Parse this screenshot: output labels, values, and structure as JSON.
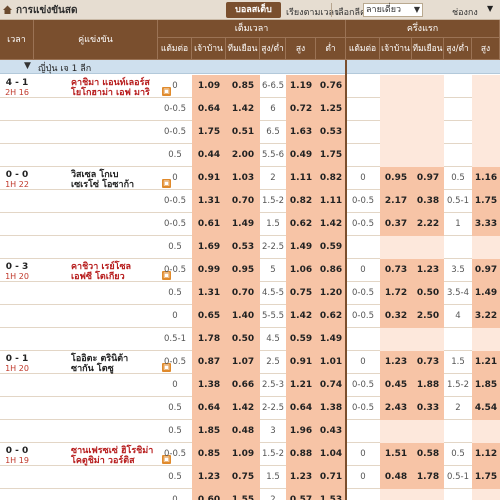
{
  "header": {
    "title": "การแข่งขันสด",
    "live_button": "บอลสเต็บ",
    "sort_label": "เรียงตามเวลา",
    "select_league_label": "เลือกลีค",
    "dropdown_value": "ลายเดี่ยว",
    "channel_label": "ช่องกง"
  },
  "columns": {
    "time": "เวลา",
    "match": "คู่แข่งขัน",
    "full_time": "เต็มเวลา",
    "half_time": "ครึ่งแรก",
    "handicap": "แต้มต่อ",
    "home": "เจ้าบ้าน",
    "away": "ทีมเยือน",
    "ou": "สูง/ต่ำ",
    "over": "สูง",
    "under": "ต่ำ",
    "h_handicap": "แต้มต่อ",
    "h_home": "เจ้าบ้าน",
    "h_away": "ทีมเยือน",
    "h_ou": "สูง/ต่ำ",
    "h_over": "สูง"
  },
  "league": {
    "name": "ญี่ปุ่น เจ 1 ลีก"
  },
  "icon_labels": {
    "tv": "▣",
    "l": "L",
    "star": "★"
  },
  "matches": [
    {
      "score": "4 - 1",
      "time": "2H 16",
      "home": "คาชิมา แอนท์เลอร์ส",
      "away": "โยโกฮาม่า เอฟ มารินอส",
      "home_red": true,
      "lines": [
        {
          "hcap": "0",
          "home": "1.09",
          "away": "0.85",
          "ou": "6-6.5",
          "over": "1.19",
          "under": "0.76"
        },
        {
          "hcap": "0-0.5",
          "home": "0.64",
          "away": "1.42",
          "ou": "6",
          "over": "0.72",
          "under": "1.25"
        },
        {
          "hcap": "0-0.5",
          "home": "1.75",
          "away": "0.51",
          "ou": "6.5",
          "over": "1.63",
          "under": "0.53"
        },
        {
          "hcap": "0.5",
          "home": "0.44",
          "away": "2.00",
          "ou": "5.5-6",
          "over": "0.49",
          "under": "1.75"
        }
      ]
    },
    {
      "score": "0 - 0",
      "time": "1H 22",
      "home": "วิสเซล โกเบ",
      "away": "เซเรโซ่ โอซาก้า",
      "home_red": false,
      "lines": [
        {
          "hcap": "0",
          "home": "0.91",
          "away": "1.03",
          "ou": "2",
          "over": "1.11",
          "under": "0.82",
          "hhcap": "0",
          "hhome": "0.95",
          "haway": "0.97",
          "hou": "0.5",
          "hover": "1.16"
        },
        {
          "hcap": "0-0.5",
          "home": "1.31",
          "away": "0.70",
          "ou": "1.5-2",
          "over": "0.82",
          "under": "1.11",
          "hhcap": "0-0.5",
          "hhome": "2.17",
          "haway": "0.38",
          "hou": "0.5-1",
          "hover": "1.75"
        },
        {
          "hcap": "0-0.5",
          "home": "0.61",
          "away": "1.49",
          "ou": "1.5",
          "over": "0.62",
          "under": "1.42",
          "hhcap": "0-0.5",
          "hhome": "0.37",
          "haway": "2.22",
          "hou": "1",
          "hover": "3.33"
        },
        {
          "hcap": "0.5",
          "home": "1.69",
          "away": "0.53",
          "ou": "2-2.5",
          "over": "1.49",
          "under": "0.59"
        }
      ]
    },
    {
      "score": "0 - 3",
      "time": "1H 20",
      "home": "คาชิวา เรย์โซล",
      "away": "เอฟซี โตเกียว",
      "home_red": true,
      "lines": [
        {
          "hcap": "0-0.5",
          "home": "0.99",
          "away": "0.95",
          "ou": "5",
          "over": "1.06",
          "under": "0.86",
          "hhcap": "0",
          "hhome": "0.73",
          "haway": "1.23",
          "hou": "3.5",
          "hover": "0.97"
        },
        {
          "hcap": "0.5",
          "home": "1.31",
          "away": "0.70",
          "ou": "4.5-5",
          "over": "0.75",
          "under": "1.20",
          "hhcap": "0-0.5",
          "hhome": "1.72",
          "haway": "0.50",
          "hou": "3.5-4",
          "hover": "1.49"
        },
        {
          "hcap": "0",
          "home": "0.65",
          "away": "1.40",
          "ou": "5-5.5",
          "over": "1.42",
          "under": "0.62",
          "hhcap": "0-0.5",
          "hhome": "0.32",
          "haway": "2.50",
          "hou": "4",
          "hover": "3.22"
        },
        {
          "hcap": "0.5-1",
          "home": "1.78",
          "away": "0.50",
          "ou": "4.5",
          "over": "0.59",
          "under": "1.49"
        }
      ]
    },
    {
      "score": "0 - 1",
      "time": "1H 20",
      "home": "โออิตะ ตรินิต้า",
      "away": "ซากัน โตซู",
      "home_red": false,
      "lines": [
        {
          "hcap": "0-0.5",
          "home": "0.87",
          "away": "1.07",
          "ou": "2.5",
          "over": "0.91",
          "under": "1.01",
          "hhcap": "0",
          "hhome": "1.23",
          "haway": "0.73",
          "hou": "1.5",
          "hover": "1.21"
        },
        {
          "hcap": "0",
          "home": "1.38",
          "away": "0.66",
          "ou": "2.5-3",
          "over": "1.21",
          "under": "0.74",
          "hhcap": "0-0.5",
          "hhome": "0.45",
          "haway": "1.88",
          "hou": "1.5-2",
          "hover": "1.85"
        },
        {
          "hcap": "0.5",
          "home": "0.64",
          "away": "1.42",
          "ou": "2-2.5",
          "over": "0.64",
          "under": "1.38",
          "hhcap": "0-0.5",
          "hhome": "2.43",
          "haway": "0.33",
          "hou": "2",
          "hover": "4.54"
        },
        {
          "hcap": "0.5",
          "home": "1.85",
          "away": "0.48",
          "ou": "3",
          "over": "1.96",
          "under": "0.43"
        }
      ]
    },
    {
      "score": "0 - 0",
      "time": "1H 19",
      "home": "ซานเฟรซเซ่ ฮิโรชิม่า",
      "away": "โคตูชิม่า วอร์ติส",
      "home_red": true,
      "lines": [
        {
          "hcap": "0-0.5",
          "home": "0.85",
          "away": "1.09",
          "ou": "1.5-2",
          "over": "0.88",
          "under": "1.04",
          "hhcap": "0",
          "hhome": "1.51",
          "haway": "0.58",
          "hou": "0.5",
          "hover": "1.12"
        },
        {
          "hcap": "0.5",
          "home": "1.23",
          "away": "0.75",
          "ou": "1.5",
          "over": "1.23",
          "under": "0.71",
          "hhcap": "0",
          "hhome": "0.48",
          "haway": "1.78",
          "hou": "0.5-1",
          "hover": "1.75"
        },
        {
          "hcap": "0",
          "home": "0.60",
          "away": "1.55",
          "ou": "2",
          "over": "0.57",
          "under": "1.53"
        }
      ]
    }
  ]
}
